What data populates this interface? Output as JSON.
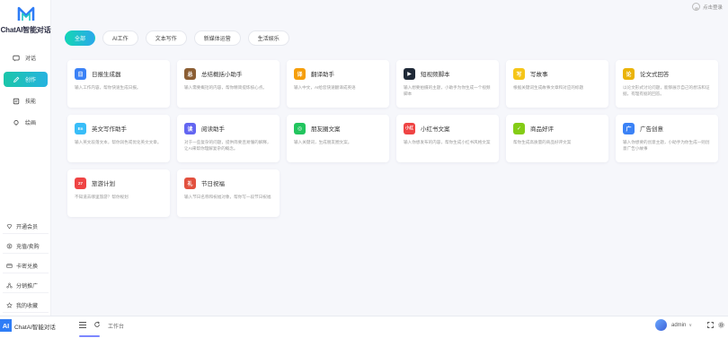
{
  "app": {
    "name": "ChatAI智能对话",
    "short": "AI"
  },
  "header": {
    "login_label": "点击登录"
  },
  "nav": [
    {
      "label": "对话",
      "icon": "chat-icon",
      "active": false
    },
    {
      "label": "创作",
      "icon": "pen-icon",
      "active": true
    },
    {
      "label": "技能",
      "icon": "skill-icon",
      "active": false
    },
    {
      "label": "绘画",
      "icon": "paint-icon",
      "active": false
    }
  ],
  "bottom_menu": [
    {
      "label": "开通会员",
      "icon": "vip-icon"
    },
    {
      "label": "充值/卖购",
      "icon": "recharge-icon"
    },
    {
      "label": "卡密兑换",
      "icon": "card-icon"
    },
    {
      "label": "分销推广",
      "icon": "share-icon"
    },
    {
      "label": "我的收藏",
      "icon": "star-icon"
    }
  ],
  "tabs": [
    {
      "label": "全部",
      "active": true
    },
    {
      "label": "AI工作",
      "active": false
    },
    {
      "label": "文本写作",
      "active": false
    },
    {
      "label": "新媒体运营",
      "active": false
    },
    {
      "label": "生活娱乐",
      "active": false
    }
  ],
  "cards": [
    {
      "title": "日报生成器",
      "desc": "输入工作内容，帮你快速生成日报。",
      "icon": "calendar-icon",
      "color": "#3b82f6",
      "glyph": "日"
    },
    {
      "title": "总结概括小助手",
      "desc": "输入需要概括的内容，帮你精简提炼核心点。",
      "icon": "briefcase-icon",
      "color": "#8b5e34",
      "glyph": "总"
    },
    {
      "title": "翻译助手",
      "desc": "输入中文，AI给您快速翻译成英语",
      "icon": "translate-icon",
      "color": "#f59e0b",
      "glyph": "译"
    },
    {
      "title": "短视频脚本",
      "desc": "输入想要拍摄的主题，小助手为你生成一个视频脚本",
      "icon": "clapper-icon",
      "color": "#1f2937",
      "glyph": "▶"
    },
    {
      "title": "写故事",
      "desc": "根据关键词生成故事文章和对应的标题",
      "icon": "notebook-icon",
      "color": "#f5c518",
      "glyph": "写"
    },
    {
      "title": "论文式回答",
      "desc": "以论文形式讨论问题，能够展示自己的想法和证据，有理有据的回答。",
      "icon": "books-icon",
      "color": "#eab308",
      "glyph": "论"
    },
    {
      "title": "英文写作助手",
      "desc": "输入英文段落文本，帮你润色或优化英文文章。",
      "icon": "english-icon",
      "color": "#38bdf8",
      "glyph": "En"
    },
    {
      "title": "阅读助手",
      "desc": "对于一些复杂的问题，提供简要且易懂的解释，让AI来帮你理解复杂的概念。",
      "icon": "reading-icon",
      "color": "#6366f1",
      "glyph": "读"
    },
    {
      "title": "朋友圈文案",
      "desc": "输入关键词，生成朋友圈文案。",
      "icon": "moments-icon",
      "color": "#22c55e",
      "glyph": "◎"
    },
    {
      "title": "小红书文案",
      "desc": "输入你想发布的内容，帮你生成小红书风格文案",
      "icon": "xiaohongshu-icon",
      "color": "#ef4444",
      "glyph": "小红"
    },
    {
      "title": "商品好评",
      "desc": "帮你生成高质量的商品好评文案",
      "icon": "praise-icon",
      "color": "#84cc16",
      "glyph": "✓"
    },
    {
      "title": "广告创意",
      "desc": "输入你想要的创意主题，小助手为你生成一则创意广告小故事",
      "icon": "megaphone-icon",
      "color": "#3b82f6",
      "glyph": "广"
    },
    {
      "title": "旅游计划",
      "desc": "不知道去哪里旅游？帮你规划",
      "icon": "calendar-27-icon",
      "color": "#ef4444",
      "glyph": "27"
    },
    {
      "title": "节日祝福",
      "desc": "输入节日名称和祝福对象，帮你写一段节日祝福",
      "icon": "gift-icon",
      "color": "#e2513f",
      "glyph": "礼"
    }
  ],
  "footer": {
    "app_name": "ChatAI智能对话",
    "crumb": "工作台",
    "user": "admin"
  }
}
